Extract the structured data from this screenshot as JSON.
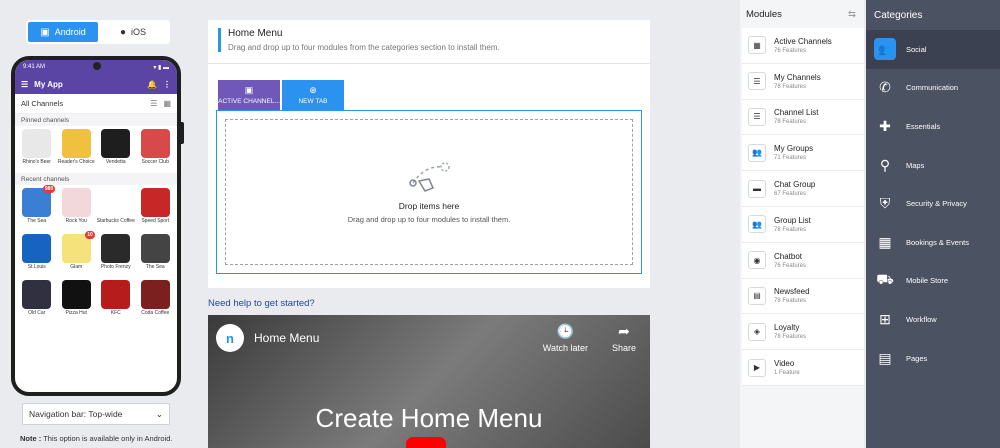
{
  "os_toggle": {
    "android": "Android",
    "ios": "iOS"
  },
  "phone": {
    "time": "9:41 AM",
    "app_title": "My App",
    "all_channels": "All Channels",
    "pinned_label": "Pinned channels",
    "recent_label": "Recent channels",
    "pinned": [
      {
        "name": "Rhino's Beer",
        "color": "#e8e8e8"
      },
      {
        "name": "Reader's Choice",
        "color": "#f0c040"
      },
      {
        "name": "Vendetta",
        "color": "#1e1e1e"
      },
      {
        "name": "Soccer Club",
        "color": "#d84a4a"
      }
    ],
    "recent": [
      {
        "name": "The Sea",
        "color": "#3b7fd4",
        "badge": "980"
      },
      {
        "name": "Rock You",
        "color": "#f2d7db",
        "badge": ""
      },
      {
        "name": "Starbucks Coffee",
        "color": "#ffffff",
        "badge": ""
      },
      {
        "name": "Speed Sport",
        "color": "#c62828",
        "badge": ""
      },
      {
        "name": "St.Louis",
        "color": "#1565c0",
        "badge": ""
      },
      {
        "name": "Glam",
        "color": "#f6e27a",
        "badge": "10"
      },
      {
        "name": "Photo Frenzy",
        "color": "#2a2a2a",
        "badge": ""
      },
      {
        "name": "The Sea",
        "color": "#444444",
        "badge": ""
      },
      {
        "name": "Old Car",
        "color": "#303040",
        "badge": ""
      },
      {
        "name": "Pizza Hut",
        "color": "#111111",
        "badge": ""
      },
      {
        "name": "KFC",
        "color": "#b71c1c",
        "badge": ""
      },
      {
        "name": "Coda Coffee",
        "color": "#7b1f1f",
        "badge": ""
      }
    ]
  },
  "nav_select": {
    "value": "Navigation bar: Top-wide"
  },
  "note": {
    "label": "Note :",
    "text": "This option is available only in Android."
  },
  "header": {
    "title": "Home Menu",
    "subtitle": "Drag and drop up to four modules from the categories section to install them."
  },
  "tabs": {
    "active": "ACTIVE CHANNEL...",
    "new": "NEW TAB"
  },
  "drop": {
    "title": "Drop items here",
    "subtitle": "Drag and drop up to four modules to install them."
  },
  "help": {
    "link": "Need help to get started?"
  },
  "video": {
    "title": "Home Menu",
    "watch_later": "Watch later",
    "share": "Share",
    "big_text": "Create Home Menu"
  },
  "modules": {
    "header": "Modules",
    "items": [
      {
        "name": "Active Channels",
        "count": "76 Features",
        "icon": "grid-icon"
      },
      {
        "name": "My Channels",
        "count": "78 Features",
        "icon": "list-icon"
      },
      {
        "name": "Channel List",
        "count": "78 Features",
        "icon": "list-icon"
      },
      {
        "name": "My Groups",
        "count": "71 Features",
        "icon": "group-icon"
      },
      {
        "name": "Chat Group",
        "count": "67 Features",
        "icon": "chat-icon"
      },
      {
        "name": "Group List",
        "count": "78 Features",
        "icon": "group-icon"
      },
      {
        "name": "Chatbot",
        "count": "76 Features",
        "icon": "bot-icon"
      },
      {
        "name": "Newsfeed",
        "count": "78 Features",
        "icon": "news-icon"
      },
      {
        "name": "Loyalty",
        "count": "78 Features",
        "icon": "tag-icon"
      },
      {
        "name": "Video",
        "count": "1 Feature",
        "icon": "video-icon"
      }
    ]
  },
  "categories": {
    "header": "Categories",
    "items": [
      {
        "name": "Social",
        "icon": "social-icon",
        "glyph": "👥"
      },
      {
        "name": "Communication",
        "icon": "phone-icon",
        "glyph": "✆"
      },
      {
        "name": "Essentials",
        "icon": "puzzle-icon",
        "glyph": "✚"
      },
      {
        "name": "Maps",
        "icon": "map-pin-icon",
        "glyph": "⚲"
      },
      {
        "name": "Security & Privacy",
        "icon": "shield-icon",
        "glyph": "⛨"
      },
      {
        "name": "Bookings & Events",
        "icon": "calendar-icon",
        "glyph": "▦"
      },
      {
        "name": "Mobile Store",
        "icon": "cart-icon",
        "glyph": "⛟"
      },
      {
        "name": "Workflow",
        "icon": "workflow-icon",
        "glyph": "⊞"
      },
      {
        "name": "Pages",
        "icon": "pages-icon",
        "glyph": "▤"
      }
    ]
  }
}
